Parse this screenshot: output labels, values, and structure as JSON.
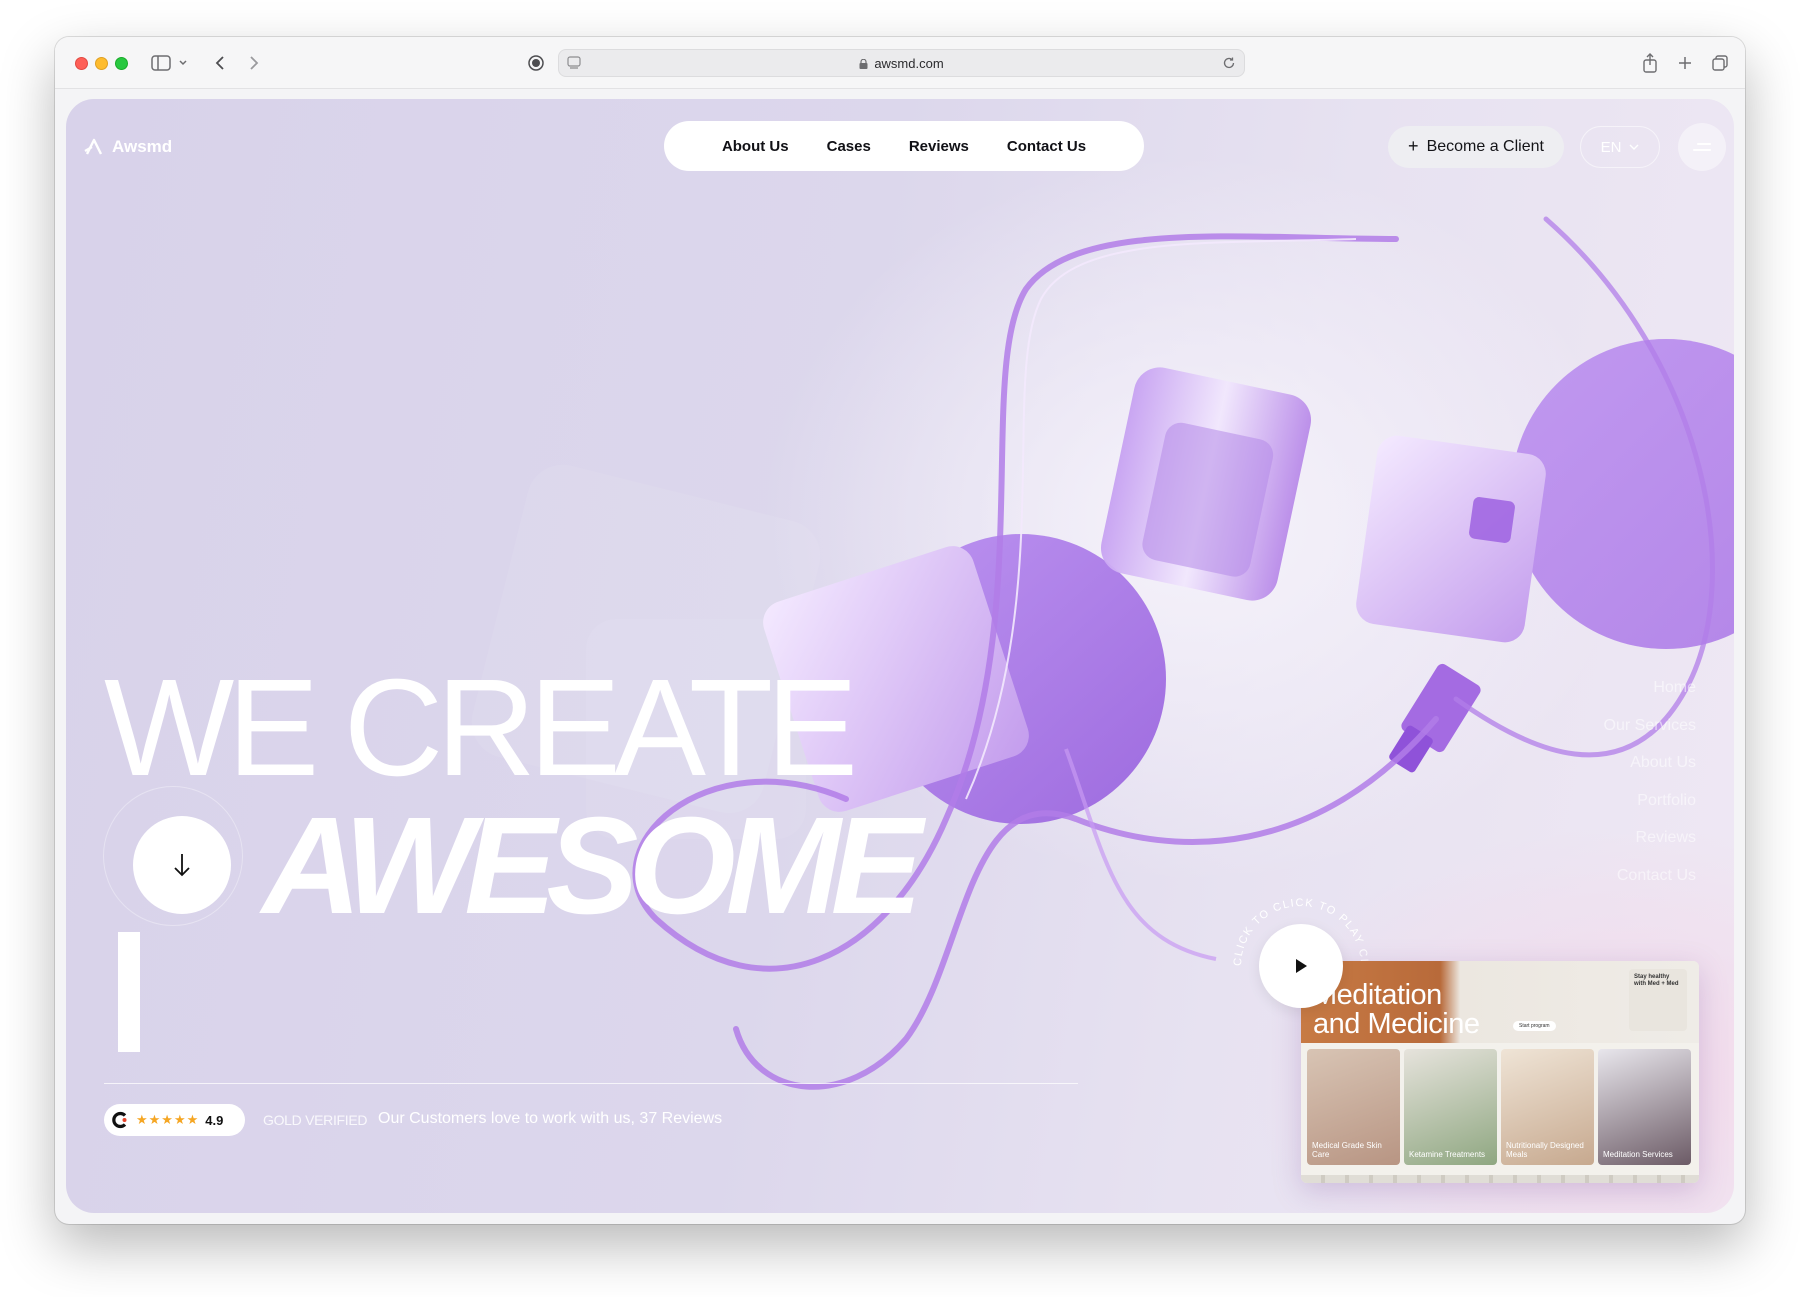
{
  "browser": {
    "url": "awsmd.com"
  },
  "header": {
    "brand": "Awsmd",
    "nav": [
      "About Us",
      "Cases",
      "Reviews",
      "Contact Us"
    ],
    "cta_label": "Become a Client",
    "lang": "EN"
  },
  "hero": {
    "line1": "WE CREATE",
    "line2": "AWESOME"
  },
  "footer_strip": {
    "rating": "4.9",
    "stars": "★★★★★",
    "badge": "GOLD VERIFIED",
    "customers": "Our Customers love to work with us, 37 Reviews"
  },
  "side_nav": [
    "Home",
    "Our Services",
    "About Us",
    "Portfolio",
    "Reviews",
    "Contact Us"
  ],
  "video": {
    "ring_text": "CLICK TO CLICK TO PLAY CLICK TO PLAY",
    "title_line1": "Meditation",
    "title_line2": "and Medicine",
    "side_title": "Stay healthy with Med + Med",
    "pill": "Start program",
    "thumbs": [
      "Medical Grade Skin Care",
      "Ketamine Treatments",
      "Nutritionally Designed Meals",
      "Meditation Services"
    ]
  },
  "colors": {
    "background": "#d9d3ea",
    "accent_purple": "#a86ee6",
    "text_white": "#ffffff"
  },
  "icons": [
    "sidebar-toggle-icon",
    "chevron-down-icon",
    "back-icon",
    "forward-icon",
    "shield-icon",
    "page-icon",
    "reload-icon",
    "share-icon",
    "new-tab-icon",
    "tabs-icon",
    "logo-icon",
    "menu-icon",
    "arrow-down-icon",
    "play-icon",
    "star-icon",
    "lock-icon"
  ]
}
